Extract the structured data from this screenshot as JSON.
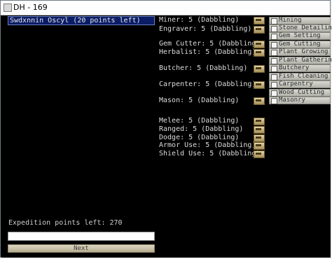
{
  "window": {
    "title": "DH - 169"
  },
  "left": {
    "selected_entry": "Swdxnnin Oscyl (20 points left)",
    "expedition_label": "Expedition points left: 270",
    "input_value": "",
    "next_label": "Next"
  },
  "skills": [
    {
      "label": "Miner: 5 (Dabbling)"
    },
    {
      "label": "Engraver: 5 (Dabbling)"
    },
    {
      "label": "Gem Cutter: 5 (Dabbling)"
    },
    {
      "label": "Herbalist: 5 (Dabbling)"
    },
    {
      "label": "Butcher: 5 (Dabbling)"
    },
    {
      "label": "Carpenter: 5 (Dabbling)"
    },
    {
      "label": "Mason: 5 (Dabbling)"
    },
    {
      "label": "Melee: 5 (Dabbling)"
    },
    {
      "label": "Ranged: 5 (Dabbling)"
    },
    {
      "label": "Dodge: 5 (Dabbling)"
    },
    {
      "label": "Armor Use: 5 (Dabbling)"
    },
    {
      "label": "Shield Use: 5 (Dabbling)"
    }
  ],
  "labors": [
    {
      "label": "Mining",
      "checked": false
    },
    {
      "label": "Stone Detailing",
      "checked": false
    },
    {
      "label": "Gem Setting",
      "checked": false
    },
    {
      "label": "Gem Cutting",
      "checked": false
    },
    {
      "label": "Plant Growing",
      "checked": false
    },
    {
      "label": "Plant Gathering",
      "checked": false
    },
    {
      "label": "Butchery",
      "checked": false
    },
    {
      "label": "Fish Cleaning",
      "checked": false
    },
    {
      "label": "Carpentry",
      "checked": false
    },
    {
      "label": "Wood Cutting",
      "checked": false
    },
    {
      "label": "Masonry",
      "checked": false
    }
  ]
}
